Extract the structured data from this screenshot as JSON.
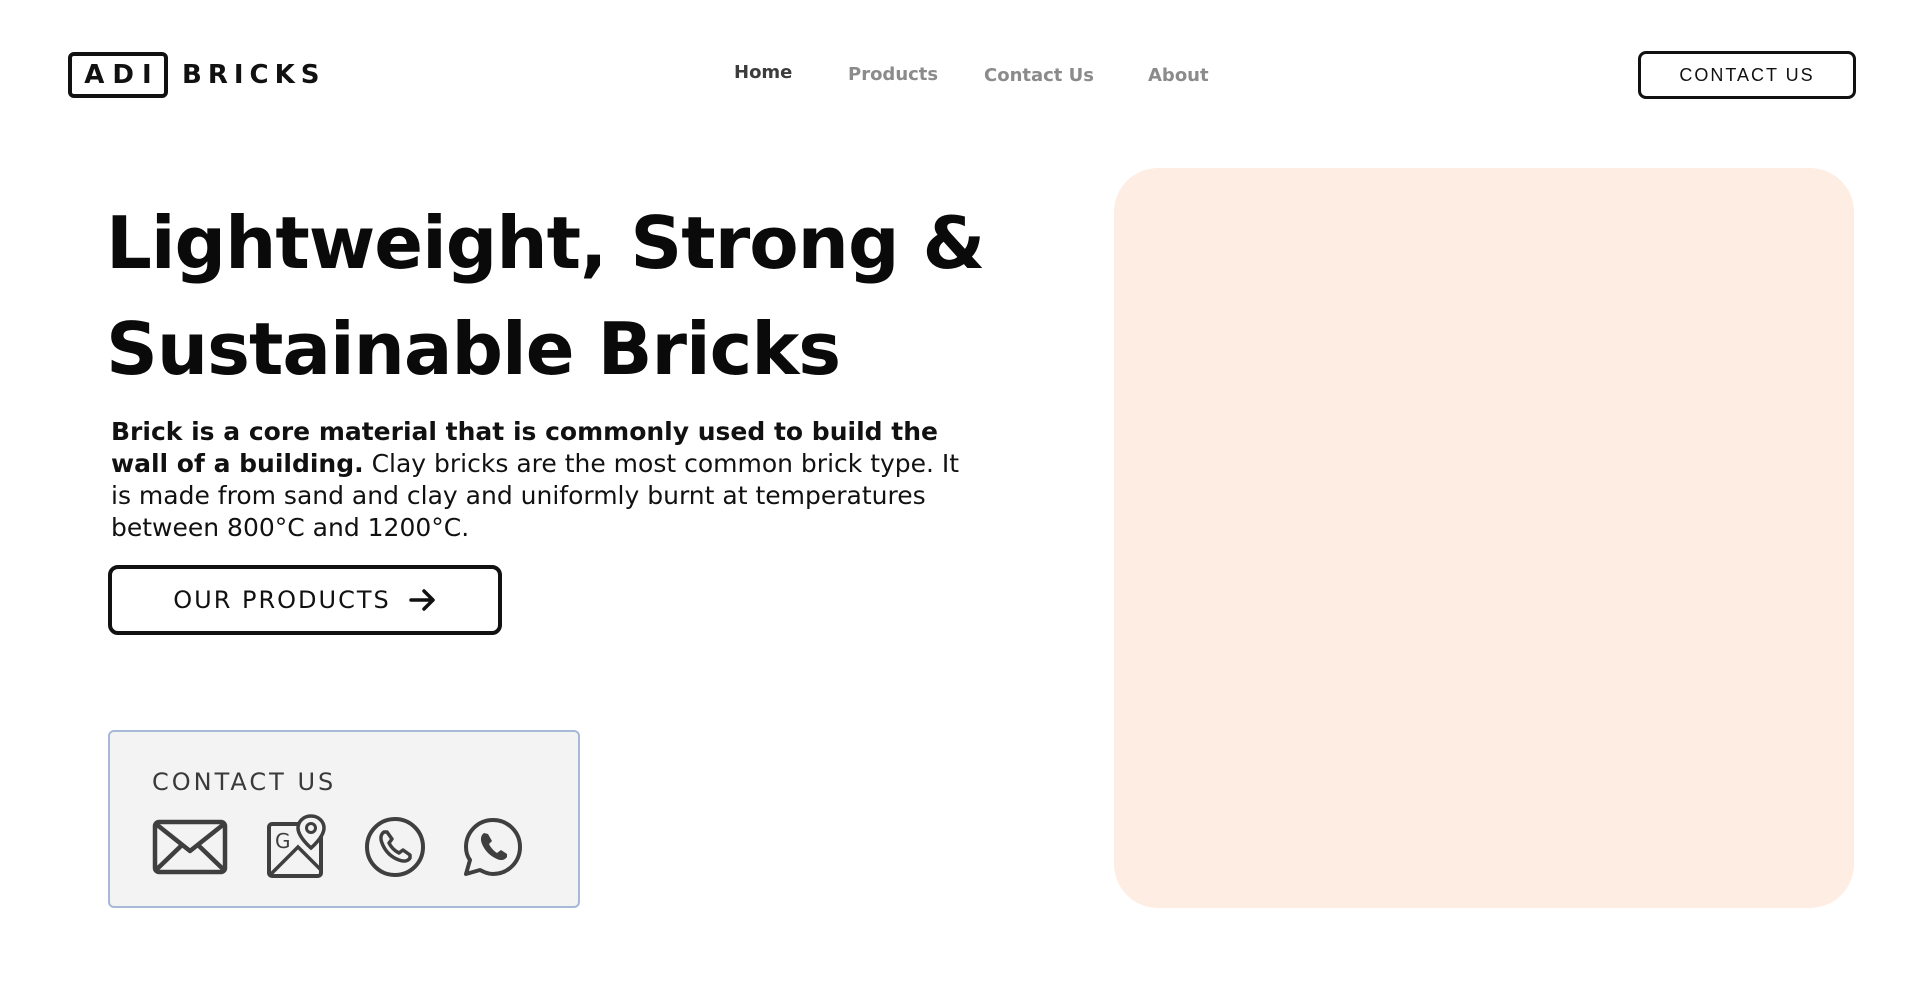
{
  "brand": {
    "box_text": "ADI",
    "name": "BRICKS"
  },
  "nav": {
    "items": [
      {
        "label": "Home",
        "active": true
      },
      {
        "label": "Products",
        "active": false
      },
      {
        "label": "Contact Us",
        "active": false
      },
      {
        "label": "About",
        "active": false
      }
    ]
  },
  "header": {
    "cta_label": "CONTACT US"
  },
  "hero": {
    "title_line1": "Lightweight, Strong &",
    "title_line2": "Sustainable Bricks",
    "desc_bold": "Brick is a core material that is commonly used to build the wall of a building.",
    "desc_rest": " Clay bricks are the most common brick type. It is made from sand and clay and uniformly burnt at temperatures between 800°C and 1200°C.",
    "button_label": "OUR PRODUCTS"
  },
  "contact_card": {
    "title": "CONTACT US",
    "icons": [
      "mail-icon",
      "google-maps-icon",
      "phone-icon",
      "whatsapp-icon"
    ]
  },
  "colors": {
    "hero_panel": "#feede3",
    "card_bg": "#f3f3f3",
    "card_border": "#a8b8d8",
    "nav_inactive": "#8b8b8b",
    "nav_active": "#3c3c3c"
  }
}
